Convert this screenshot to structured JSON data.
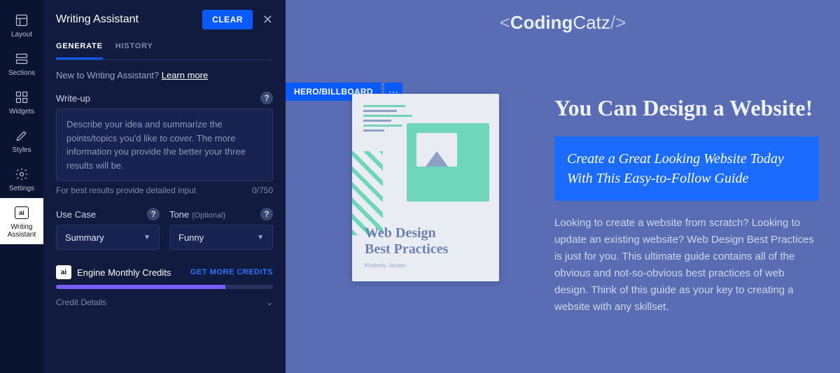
{
  "rail": {
    "items": [
      {
        "label": "Layout"
      },
      {
        "label": "Sections"
      },
      {
        "label": "Widgets"
      },
      {
        "label": "Styles"
      },
      {
        "label": "Settings"
      },
      {
        "label": "Writing\nAssistant"
      }
    ]
  },
  "panel": {
    "title": "Writing Assistant",
    "clear": "CLEAR",
    "tabs": {
      "generate": "GENERATE",
      "history": "HISTORY"
    },
    "new_to": "New to Writing Assistant? ",
    "learn_more": "Learn more",
    "writeup_label": "Write-up",
    "writeup_placeholder": "Describe your idea and summarize the points/topics you'd like to cover. The more information you provide the better your three results will be.",
    "hint": "For best results provide detailed input",
    "counter": "0/750",
    "usecase_label": "Use Case",
    "usecase_value": "Summary",
    "tone_label": "Tone",
    "tone_optional": "(Optional)",
    "tone_value": "Funny",
    "credits_label": "Engine Monthly Credits",
    "get_more": "GET MORE CREDITS",
    "credit_details": "Credit Details"
  },
  "canvas": {
    "brand_open": "< ",
    "brand_bold": "Coding",
    "brand_rest": "Catz",
    "brand_close": " />",
    "section_tag": "HERO/BILLBOARD",
    "book_title": "Web Design\nBest Practices",
    "book_author": "Kimberly Jensen",
    "headline": "You Can Design a Website!",
    "subhead": "Create a Great Looking Website Today With This Easy-to-Follow Guide",
    "paragraph": "Looking to create a website from scratch? Looking to update an existing website? Web Design Best Practices is just for you. This ultimate guide contains all of the obvious and not-so-obvious best practices of web design. Think of this guide as your key to creating a website with any skillset."
  }
}
